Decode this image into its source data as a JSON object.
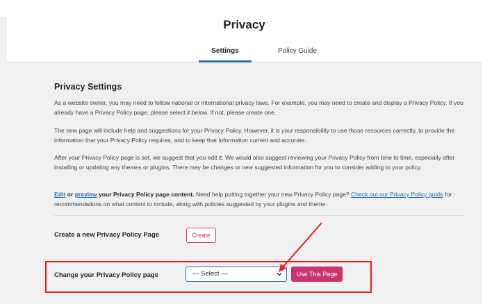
{
  "header": {
    "title": "Privacy",
    "tabs": [
      {
        "label": "Settings",
        "active": true
      },
      {
        "label": "Policy Guide",
        "active": false
      }
    ]
  },
  "main": {
    "section_title": "Privacy Settings",
    "paragraphs": [
      "As a website owner, you may need to follow national or international privacy laws. For example, you may need to create and display a Privacy Policy. If you already have a Privacy Policy page, please select it below. If not, please create one.",
      "The new page will include help and suggestions for your Privacy Policy. However, it is your responsibility to use those resources correctly, to provide the information that your Privacy Policy requires, and to keep that information current and accurate.",
      "After your Privacy Policy page is set, we suggest that you edit it. We would also suggest reviewing your Privacy Policy from time to time, especially after installing or updating any themes or plugins. There may be changes or new suggested information for you to consider adding to your policy."
    ],
    "edit_para": {
      "edit_link": "Edit",
      "or_text": " or ",
      "preview_link": "preview",
      "strong_tail": " your Privacy Policy page content.",
      "middle": " Need help putting together your new Privacy Policy page? ",
      "guide_link": "Check out our Privacy Policy guide",
      "end": " for recommendations on what content to include, along with policies suggested by your plugins and theme."
    },
    "create_row": {
      "label": "Create a new Privacy Policy Page",
      "button": "Create"
    },
    "change_row": {
      "label": "Change your Privacy Policy page",
      "select_value": "— Select —",
      "button": "Use This Page"
    }
  },
  "colors": {
    "accent_blue": "#2271b1",
    "button_pink": "#c9356e",
    "annotation_red": "#e51d1d"
  }
}
